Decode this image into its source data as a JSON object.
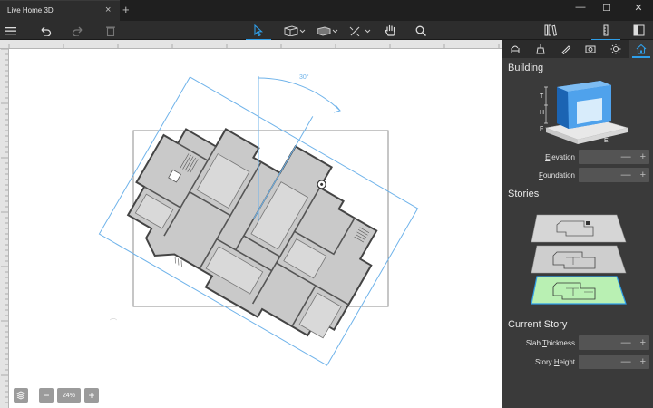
{
  "window": {
    "tab_title": "Live Home 3D",
    "tab_close": "×",
    "tab_add": "+",
    "minimize": "—",
    "maximize": "☐",
    "close": "✕"
  },
  "toolbar": {
    "icons": [
      "menu-icon",
      "undo-icon",
      "redo-icon",
      "trash-icon",
      "select-arrow-icon",
      "wall-tool-icon",
      "room-tool-icon",
      "measure-tool-icon",
      "pan-hand-icon",
      "search-icon",
      "library-icon",
      "inspector-icon",
      "layout-icon"
    ],
    "accent": "#2f9ee8"
  },
  "canvas": {
    "floor_plan": "floor-plan-drawing",
    "angle_label": "30°",
    "zoom_level": "24%",
    "zoom_minus": "−",
    "zoom_plus": "+"
  },
  "panel": {
    "tabs": [
      "furniture-tab-icon",
      "material-tab-icon",
      "paint-tab-icon",
      "camera-tab-icon",
      "light-tab-icon",
      "building-tab-icon"
    ],
    "building_title": "Building",
    "diagram_labels": {
      "t": "T",
      "h": "H",
      "f": "F",
      "e": "E"
    },
    "elevation_label_underlined": "E",
    "elevation_label_rest": "levation",
    "foundation_label_underlined": "F",
    "foundation_label_rest": "oundation",
    "stories_title": "Stories",
    "current_story_title": "Current Story",
    "slab_label_prefix": "Slab ",
    "slab_label_underlined": "T",
    "slab_label_rest": "hickness",
    "story_height_prefix": "Story ",
    "story_height_underlined": "H",
    "story_height_rest": "eight",
    "minus": "—",
    "plus": "+",
    "story_active_color": "#b9f0b3"
  }
}
